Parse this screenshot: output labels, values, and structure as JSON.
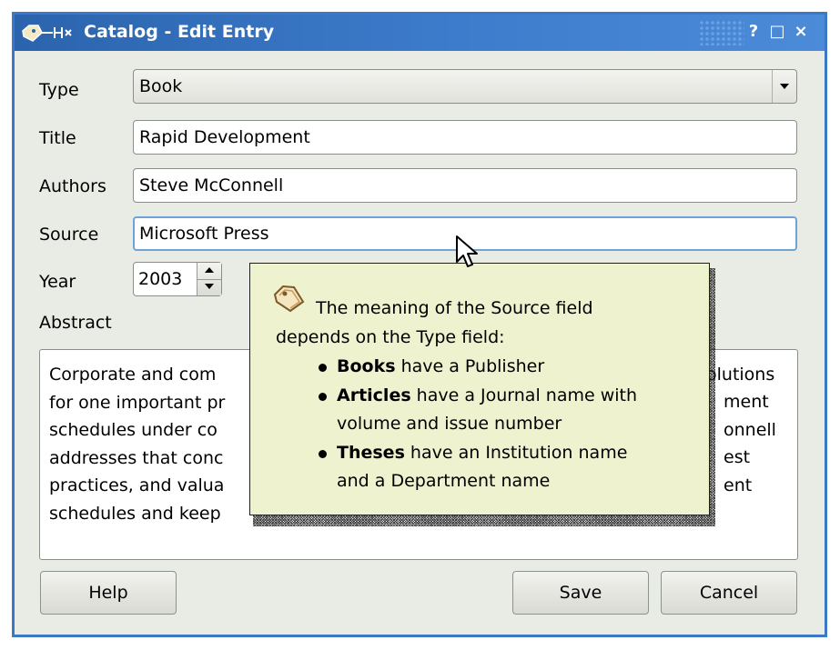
{
  "window": {
    "title": "Catalog - Edit Entry",
    "controls": [
      "?",
      "□",
      "×"
    ]
  },
  "form": {
    "type_label": "Type",
    "type_value": "Book",
    "title_label": "Title",
    "title_value": "Rapid Development",
    "authors_label": "Authors",
    "authors_value": "Steve McConnell",
    "source_label": "Source",
    "source_value": "Microsoft Press",
    "year_label": "Year",
    "year_value": "2003",
    "abstract_label": "Abstract",
    "abstract_lines": [
      "Corporate and com",
      "for one important pr",
      "schedules under co",
      "addresses that conc",
      "practices, and valua",
      "schedules and keep"
    ],
    "abstract_right_lines": [
      "olutions",
      "ment",
      "onnell",
      "est",
      "ent"
    ]
  },
  "tooltip": {
    "line1": "The meaning of the Source field",
    "line2": "depends on the Type field:",
    "bullets": [
      {
        "bold": "Books",
        "rest": " have a Publisher"
      },
      {
        "bold": "Articles",
        "rest": " have a Journal name with"
      },
      {
        "bold": "",
        "rest": "volume and issue number"
      },
      {
        "bold": "Theses",
        "rest": " have an Institution name"
      },
      {
        "bold": "",
        "rest": "and a Department name"
      }
    ]
  },
  "buttons": {
    "help": "Help",
    "save": "Save",
    "cancel": "Cancel"
  },
  "colors": {
    "titlebar": "#3d7ccc",
    "window_bg": "#e9ebe5",
    "tooltip_bg": "#eef2cf",
    "focus_border": "#6fa3d8"
  },
  "icons": {
    "title_icon": "tag-icon",
    "tooltip_icon": "tag-icon",
    "pointer": "mouse-cursor-icon"
  }
}
